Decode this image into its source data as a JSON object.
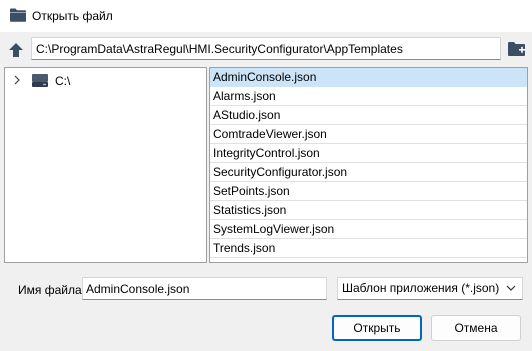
{
  "window": {
    "title": "Открыть файл"
  },
  "toolbar": {
    "path": "C:\\ProgramData\\AstraRegul\\HMI.SecurityConfigurator\\AppTemplates"
  },
  "tree": {
    "items": [
      {
        "label": "C:\\"
      }
    ]
  },
  "files": {
    "selected_index": 0,
    "items": [
      "AdminConsole.json",
      "Alarms.json",
      "AStudio.json",
      "ComtradeViewer.json",
      "IntegrityControl.json",
      "SecurityConfigurator.json",
      "SetPoints.json",
      "Statistics.json",
      "SystemLogViewer.json",
      "Trends.json"
    ]
  },
  "footer": {
    "filename_label": "Имя файла:",
    "filename_value": "AdminConsole.json",
    "filter_value": "Шаблон приложения (*.json)",
    "open_label": "Открыть",
    "cancel_label": "Отмена"
  },
  "colors": {
    "accent": "#0067c0",
    "selection": "#cce4f7",
    "folder": "#3c4e63"
  }
}
